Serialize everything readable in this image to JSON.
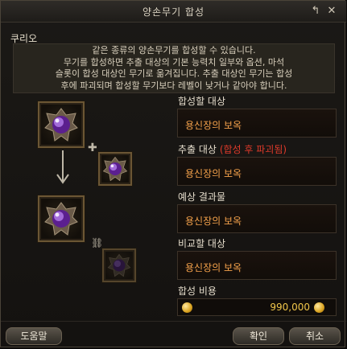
{
  "window": {
    "title": "양손무기 합성",
    "icons": [
      "restore-icon",
      "close-icon"
    ]
  },
  "npc_name": "쿠리오",
  "description": [
    "같은 종류의 양손무기를 합성할 수 있습니다.",
    "무기를 합성하면 추출 대상의 기본 능력치 일부와 옵션, 마석",
    "슬롯이 합성 대상인 무기로 옮겨집니다. 추출 대상인 무기는 합성",
    "후에 파괴되며 합성할 무기보다 레벨이 낮거나 같아야 합니다."
  ],
  "fields": {
    "target": {
      "label": "합성할 대상",
      "value": "용신장의 보옥"
    },
    "extract": {
      "label": "추출 대상",
      "warning": "(합성 후 파괴됨)",
      "value": "용신장의 보옥"
    },
    "result": {
      "label": "예상 결과물",
      "value": "용신장의 보옥"
    },
    "compare": {
      "label": "비교할 대상",
      "value": "용신장의 보옥"
    }
  },
  "cost": {
    "label": "합성 비용",
    "value": "990,000"
  },
  "buttons": {
    "help": "도움말",
    "confirm": "확인",
    "cancel": "취소"
  },
  "colors": {
    "item_name": "#f5a24b",
    "warning": "#e03a2a",
    "gold": "#f0c64a"
  }
}
